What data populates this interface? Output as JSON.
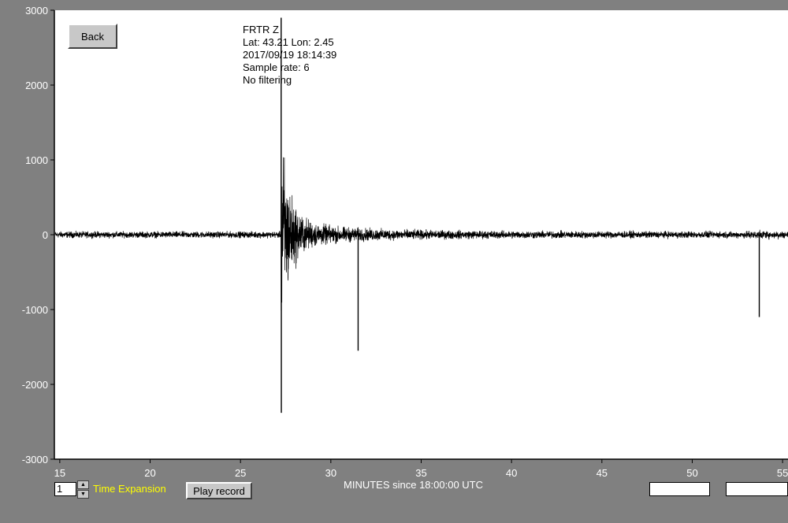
{
  "back_label": "Back",
  "play_label": "Play record",
  "time_expansion_label": "Time Expansion",
  "time_expansion_value": "1",
  "info": {
    "station": "FRTR  Z",
    "location": "Lat: 43.21 Lon: 2.45",
    "datetime": "2017/09/19 18:14:39",
    "sample_rate": "Sample rate: 6",
    "filter": "No filtering"
  },
  "chart_data": {
    "type": "line",
    "xlabel": "MINUTES since 18:00:00 UTC",
    "ylabel": "",
    "xlim": [
      14.7,
      55.3
    ],
    "ylim": [
      -3000,
      3000
    ],
    "xticks": [
      15,
      20,
      25,
      30,
      35,
      40,
      45,
      50,
      55
    ],
    "yticks": [
      3000,
      2000,
      1000,
      0,
      -1000,
      -2000,
      -3000
    ],
    "grid": false,
    "noise_level": 60,
    "events": [
      {
        "x": 27.25,
        "peak_high": 2900,
        "peak_low": -2380
      },
      {
        "x": 31.5,
        "peak_low": -1550
      },
      {
        "x": 53.7,
        "peak_low": -1100
      }
    ]
  }
}
